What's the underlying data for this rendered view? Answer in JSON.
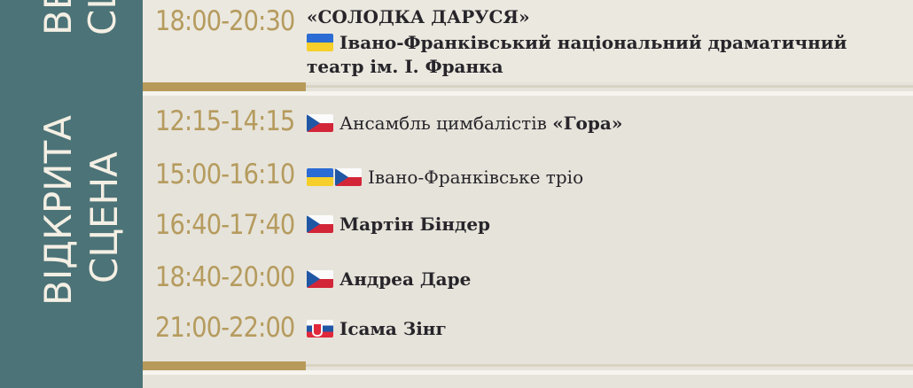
{
  "sections": {
    "top_label_1": "ВЕ",
    "top_label_2": "СЦ",
    "open_stage_line1": "ВІДКРИТА",
    "open_stage_line2": "СЦЕНА"
  },
  "top_event": {
    "time": "18:00-20:30",
    "title": "«СОЛОДКА ДАРУСЯ»",
    "venue_line1": "Івано-Франківський національний драматичний",
    "venue_line2": "театр ім. І. Франка",
    "flag": "ukraine-flag"
  },
  "open_stage": [
    {
      "time": "12:15-14:15",
      "prefix": "Ансамбль цимбалістів ",
      "bold": "«Гора»",
      "flags": [
        "czech-flag"
      ]
    },
    {
      "time": "15:00-16:10",
      "prefix": "Івано-Франківське тріо",
      "bold": "",
      "flags": [
        "ukraine-flag",
        "czech-flag"
      ]
    },
    {
      "time": "16:40-17:40",
      "prefix": "",
      "bold": "Мартін Біндер",
      "flags": [
        "czech-flag"
      ]
    },
    {
      "time": "18:40-20:00",
      "prefix": "",
      "bold": "Андреа Даре",
      "flags": [
        "czech-flag"
      ]
    },
    {
      "time": "21:00-22:00",
      "prefix": "",
      "bold": "Ісама Зінг",
      "flags": [
        "slovak-flag"
      ]
    }
  ],
  "colors": {
    "band": "#4c7377",
    "gold": "#b59b5e",
    "background": "#e6e3da",
    "text": "#27252a"
  }
}
